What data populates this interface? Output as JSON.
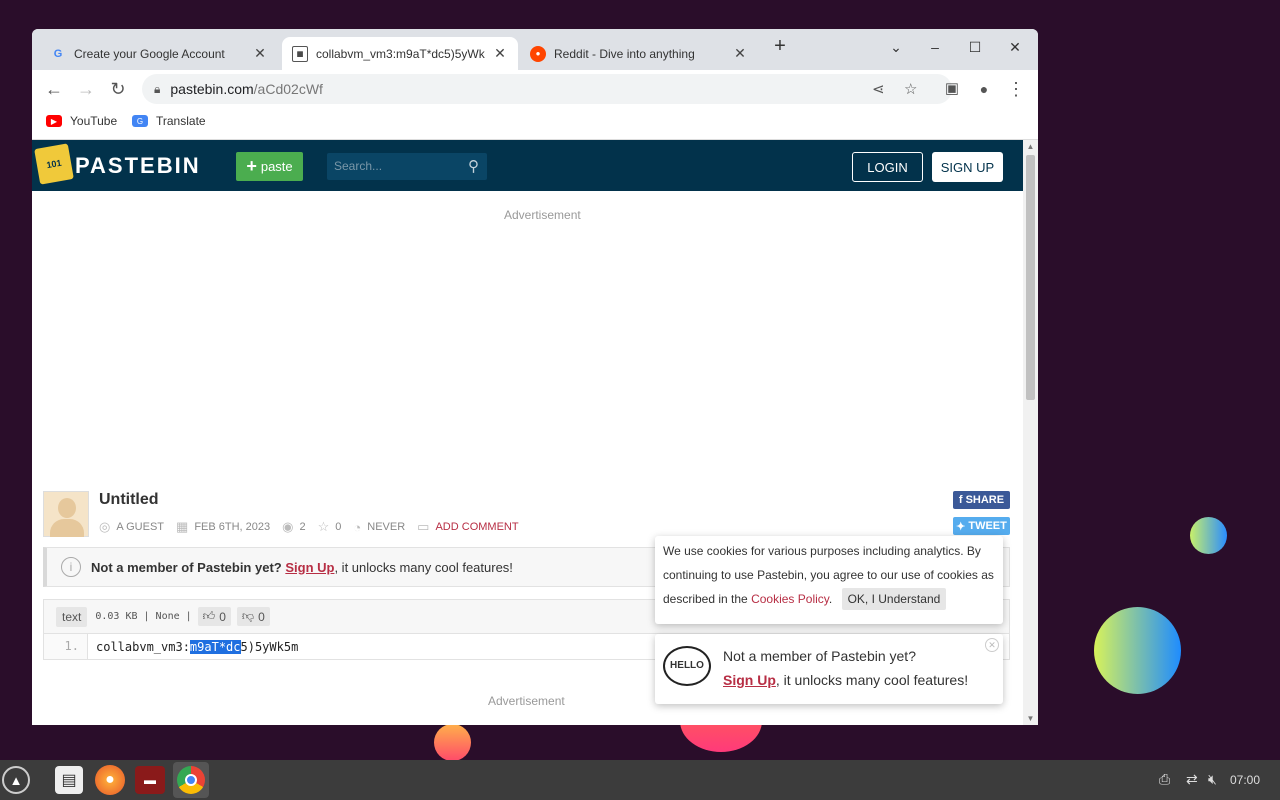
{
  "browser": {
    "tabs": [
      {
        "title": "Create your Google Account",
        "favicon": "G"
      },
      {
        "title": "collabvm_vm3:m9aT*dc5)5yWk",
        "favicon": "paste-icon"
      },
      {
        "title": "Reddit - Dive into anything",
        "favicon": "reddit-icon"
      }
    ],
    "url_host": "pastebin.com",
    "url_path": "/aCd02cWf",
    "bookmarks": [
      {
        "label": "YouTube",
        "color": "#ff0000"
      },
      {
        "label": "Translate",
        "color": "#4285f4"
      }
    ]
  },
  "pastebin": {
    "logo_text": "PASTEBIN",
    "paste_button": "paste",
    "search_placeholder": "Search...",
    "login": "LOGIN",
    "signup": "SIGN UP",
    "advertisement": "Advertisement",
    "title": "Untitled",
    "author": "A GUEST",
    "date": "FEB 6TH, 2023",
    "views": "2",
    "stars": "0",
    "expiry": "NEVER",
    "add_comment": "ADD COMMENT",
    "share": "SHARE",
    "tweet": "TWEET",
    "notice_prefix": "Not a member of Pastebin yet?",
    "notice_link": "Sign Up",
    "notice_suffix": ", it unlocks many cool features!",
    "format": "text",
    "size_info": "0.03 KB | None |",
    "likes": "0",
    "dislikes": "0",
    "line_number": "1.",
    "code_before": "collabvm_vm3:",
    "code_selected": "m9aT*dc",
    "code_after": "5)5yWk5m",
    "advertisement2": "Advertisement"
  },
  "cookie": {
    "text": "We use cookies for various purposes including analytics. By continuing to use Pastebin, you agree to our use of cookies as described in the",
    "link": "Cookies Policy",
    "period": ".",
    "ok": "OK, I Understand"
  },
  "hello_popup": {
    "badge": "HELLO",
    "line1": "Not a member of Pastebin yet?",
    "link": "Sign Up",
    "suffix": ", it unlocks many cool features!"
  },
  "taskbar": {
    "clock": "07:00"
  },
  "colors": {
    "pastebin_header": "#02324b",
    "accent_red": "#b72e44",
    "paste_green": "#4bad4f"
  }
}
